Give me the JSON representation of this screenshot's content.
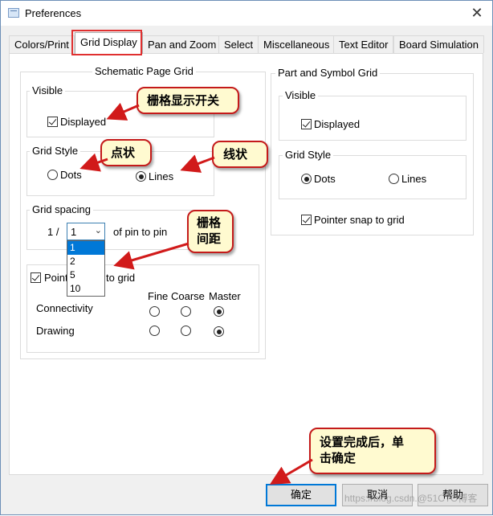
{
  "window": {
    "title": "Preferences",
    "close_glyph": "✕"
  },
  "tabs": [
    {
      "label": "Colors/Print"
    },
    {
      "label": "Grid Display",
      "active": true
    },
    {
      "label": "Pan and Zoom"
    },
    {
      "label": "Select"
    },
    {
      "label": "Miscellaneous"
    },
    {
      "label": "Text Editor"
    },
    {
      "label": "Board Simulation"
    }
  ],
  "schematic_grid": {
    "title": "Schematic Page Grid",
    "visible": {
      "title": "Visible",
      "displayed_label": "Displayed",
      "displayed_checked": true
    },
    "grid_style": {
      "title": "Grid Style",
      "dots_label": "Dots",
      "lines_label": "Lines",
      "selected": "Lines"
    },
    "grid_spacing": {
      "title": "Grid spacing",
      "prefix": "1 /",
      "value": "1",
      "suffix": "of pin to pin",
      "options": [
        "1",
        "2",
        "5",
        "10"
      ]
    },
    "pointer_snap": {
      "label_start": "Pointe",
      "label_end": "to grid",
      "checked": true,
      "columns": [
        "Fine",
        "Coarse",
        "Master"
      ],
      "rows": [
        {
          "label": "Connectivity",
          "selected": "Master"
        },
        {
          "label": "Drawing",
          "selected": "Master"
        }
      ]
    }
  },
  "part_grid": {
    "title": "Part and Symbol Grid",
    "visible": {
      "title": "Visible",
      "displayed_label": "Displayed",
      "displayed_checked": true
    },
    "grid_style": {
      "title": "Grid Style",
      "dots_label": "Dots",
      "lines_label": "Lines",
      "selected": "Dots"
    },
    "pointer_snap": {
      "label": "Pointer snap to grid",
      "checked": true
    }
  },
  "callouts": {
    "grid_toggle": "栅格显示开关",
    "dots": "点状",
    "lines": "线状",
    "spacing": "栅格\n间距",
    "confirm": "设置完成后，单\n击确定"
  },
  "buttons": {
    "ok": "确定",
    "cancel": "取消",
    "help": "帮助"
  },
  "watermark": "https://blog.csdn.@51CTO博客",
  "colors": {
    "callout_border": "#c41a1a",
    "callout_fill": "#fffad0",
    "accent": "#0078d7",
    "tab_highlight": "#e03030"
  }
}
